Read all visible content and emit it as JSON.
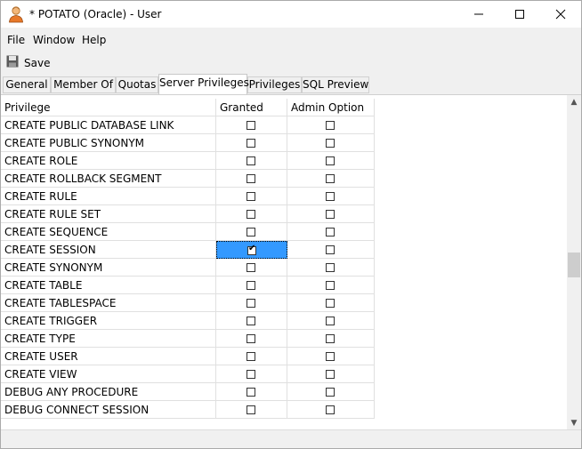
{
  "window": {
    "title": "* POTATO (Oracle) - User"
  },
  "menu": [
    "File",
    "Window",
    "Help"
  ],
  "toolbar": {
    "save_label": "Save"
  },
  "tabs": [
    {
      "label": "General",
      "active": false
    },
    {
      "label": "Member Of",
      "active": false
    },
    {
      "label": "Quotas",
      "active": false
    },
    {
      "label": "Server Privileges",
      "active": true
    },
    {
      "label": "Privileges",
      "active": false
    },
    {
      "label": "SQL Preview",
      "active": false
    }
  ],
  "table": {
    "columns": [
      "Privilege",
      "Granted",
      "Admin Option"
    ],
    "rows": [
      {
        "privilege": "CREATE PUBLIC DATABASE LINK",
        "granted": false,
        "admin": false
      },
      {
        "privilege": "CREATE PUBLIC SYNONYM",
        "granted": false,
        "admin": false
      },
      {
        "privilege": "CREATE ROLE",
        "granted": false,
        "admin": false
      },
      {
        "privilege": "CREATE ROLLBACK SEGMENT",
        "granted": false,
        "admin": false
      },
      {
        "privilege": "CREATE RULE",
        "granted": false,
        "admin": false
      },
      {
        "privilege": "CREATE RULE SET",
        "granted": false,
        "admin": false
      },
      {
        "privilege": "CREATE SEQUENCE",
        "granted": false,
        "admin": false
      },
      {
        "privilege": "CREATE SESSION",
        "granted": true,
        "admin": false,
        "selected": true
      },
      {
        "privilege": "CREATE SYNONYM",
        "granted": false,
        "admin": false
      },
      {
        "privilege": "CREATE TABLE",
        "granted": false,
        "admin": false
      },
      {
        "privilege": "CREATE TABLESPACE",
        "granted": false,
        "admin": false
      },
      {
        "privilege": "CREATE TRIGGER",
        "granted": false,
        "admin": false
      },
      {
        "privilege": "CREATE TYPE",
        "granted": false,
        "admin": false
      },
      {
        "privilege": "CREATE USER",
        "granted": false,
        "admin": false
      },
      {
        "privilege": "CREATE VIEW",
        "granted": false,
        "admin": false
      },
      {
        "privilege": "DEBUG ANY PROCEDURE",
        "granted": false,
        "admin": false
      },
      {
        "privilege": "DEBUG CONNECT SESSION",
        "granted": false,
        "admin": false
      }
    ]
  },
  "colors": {
    "selection": "#3399ff",
    "window_bg": "#f0f0f0"
  },
  "icons": [
    "user-icon",
    "minimize-icon",
    "maximize-icon",
    "close-icon",
    "save-icon",
    "scroll-up-icon",
    "scroll-down-icon"
  ]
}
